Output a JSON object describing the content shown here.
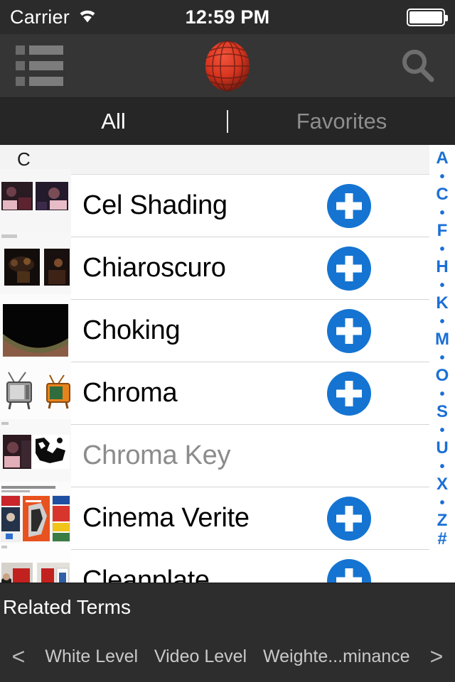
{
  "status_bar": {
    "carrier": "Carrier",
    "wifi_icon": "wifi-icon",
    "time": "12:59 PM",
    "battery_icon": "battery-full-icon",
    "battery_level": 100
  },
  "nav_bar": {
    "menu_icon": "list-menu-icon",
    "logo_icon": "red-globe-logo",
    "search_icon": "search-icon",
    "accent_color": "#d93b28",
    "background_color": "#353535"
  },
  "tabs": [
    {
      "label": "All",
      "active": true
    },
    {
      "label": "Favorites",
      "active": false
    }
  ],
  "list": {
    "section_header": "C",
    "rows": [
      {
        "title": "Cel Shading",
        "thumb": "thumb-cel-shading",
        "disabled": false,
        "add_icon": "plus-circle-icon"
      },
      {
        "title": "Chiaroscuro",
        "thumb": "thumb-chiaroscuro",
        "disabled": false,
        "add_icon": "plus-circle-icon"
      },
      {
        "title": "Choking",
        "thumb": "thumb-choking",
        "disabled": false,
        "add_icon": "plus-circle-icon"
      },
      {
        "title": "Chroma",
        "thumb": "thumb-chroma",
        "disabled": false,
        "add_icon": "plus-circle-icon"
      },
      {
        "title": "Chroma Key",
        "thumb": "thumb-chroma-key",
        "disabled": true,
        "add_icon": null
      },
      {
        "title": "Cinema Verite",
        "thumb": "thumb-cinema-verite",
        "disabled": false,
        "add_icon": "plus-circle-icon"
      },
      {
        "title": "Cleanplate",
        "thumb": "thumb-cleanplate",
        "disabled": false,
        "add_icon": "plus-circle-icon"
      }
    ]
  },
  "index_bar": {
    "accent_color": "#1b6fd6",
    "entries": [
      "A",
      "•",
      "C",
      "•",
      "F",
      "•",
      "H",
      "•",
      "K",
      "•",
      "M",
      "•",
      "O",
      "•",
      "S",
      "•",
      "U",
      "•",
      "X",
      "•",
      "Z",
      "#"
    ]
  },
  "related_terms": {
    "title": "Related Terms",
    "prev_label": "<",
    "next_label": ">",
    "items": [
      "White Level",
      "Video Level",
      "Weighte...minance"
    ]
  }
}
